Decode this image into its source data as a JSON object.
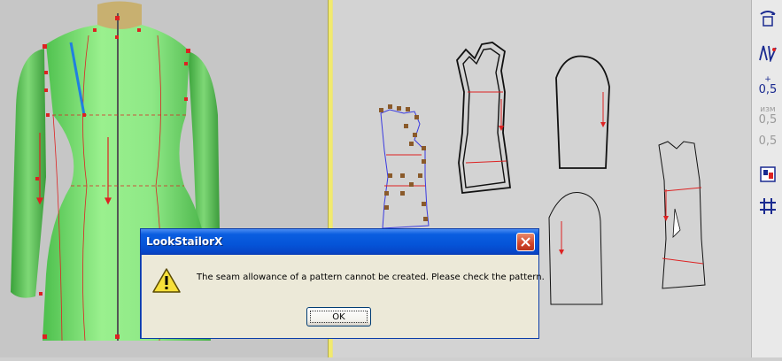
{
  "dialog": {
    "title": "LookStailorX",
    "message": "The seam allowance of a pattern cannot be created. Please check the pattern.",
    "ok_label": "OK",
    "icon": "warning-icon",
    "title_color": "#0554d8"
  },
  "toolbar": {
    "buttons": [
      {
        "name": "rotate-pattern-icon",
        "label": ""
      },
      {
        "name": "edit-lines-icon",
        "label": ""
      },
      {
        "name": "add-seam-allowance-button",
        "label": "0,5",
        "prefix": "+"
      },
      {
        "name": "edit-seam-allowance-button",
        "label": "0,5",
        "prefix": "изм"
      },
      {
        "name": "delete-seam-allowance-button",
        "label": "0,5"
      },
      {
        "name": "layout-icon",
        "label": ""
      },
      {
        "name": "grid-icon",
        "label": ""
      }
    ]
  },
  "colors": {
    "divider": "#f1ea6e",
    "mannequin": "#7ee07a",
    "grain_line": "#e01010",
    "pattern_outline": "#111111",
    "point_marker": "#8a5a2a"
  }
}
